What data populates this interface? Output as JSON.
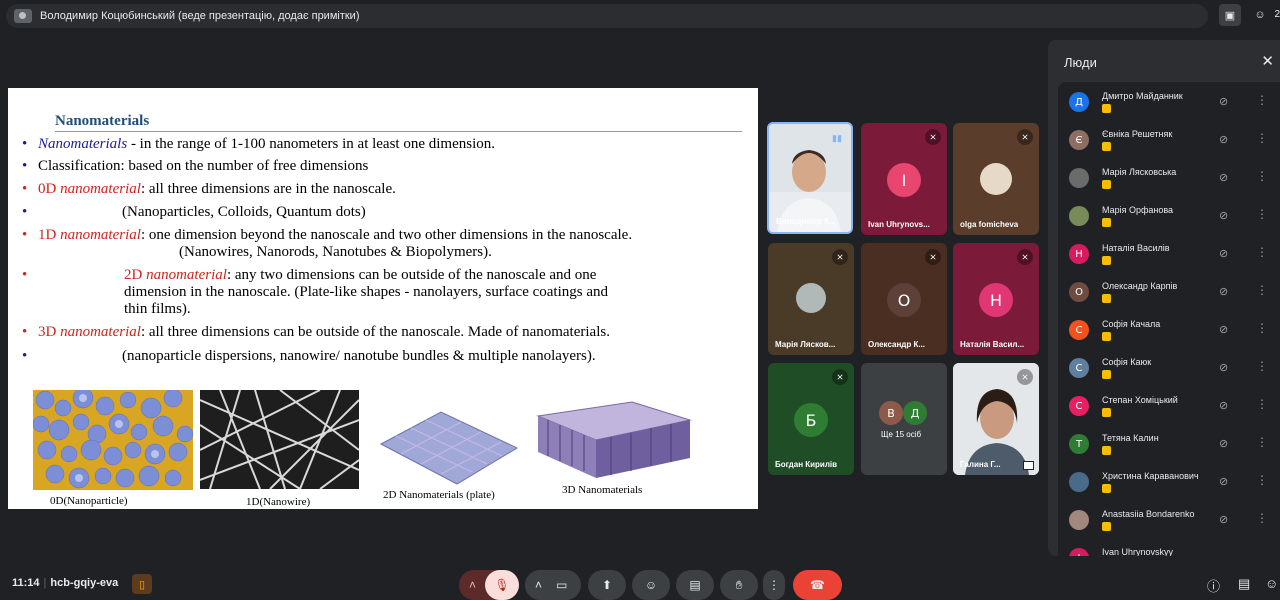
{
  "top": {
    "presenter_text": "Володимир Коцюбинський (веде презентацію, додає примітки)",
    "count": "2"
  },
  "slide": {
    "title": "Nanomaterials",
    "bullets": [
      {
        "lead": "Nanomaterials",
        "rest": " - in the range of 1-100 nanometers in at least one dimension."
      },
      {
        "text": "Classification: based on the number of free dimensions"
      },
      {
        "lead_plain": "0D ",
        "lead": "nanomaterial",
        "rest": ": all three dimensions are in the nanoscale."
      },
      {
        "text": "(Nanoparticles, Colloids, Quantum dots)"
      },
      {
        "lead_plain": "1D ",
        "lead": "nanomaterial",
        "rest": ": one dimension beyond the nanoscale and two other dimensions in the nanoscale.",
        "line2": "(Nanowires, Nanorods, Nanotubes & Biopolymers)."
      },
      {
        "lead_plain": "2D ",
        "lead": "nanomaterial",
        "rest": ": any two dimensions can be outside of the nanoscale and one",
        "line2": "dimension in the nanoscale.       (Plate-like shapes - nanolayers, surface coatings and",
        "line3": "thin films)."
      },
      {
        "lead_plain": "3D ",
        "lead": "nanomaterial",
        "rest": ": all three dimensions can be outside of the nanoscale. Made of nanomaterials."
      },
      {
        "text": "(nanoparticle dispersions, nanowire/ nanotube bundles & multiple nanolayers)."
      }
    ],
    "captions": [
      "0D(Nanoparticle)",
      "1D(Nanowire)",
      "2D Nanomaterials (plate)",
      "3D Nanomaterials"
    ]
  },
  "tiles": [
    {
      "name": "Володимир К...",
      "avatar": ""
    },
    {
      "name": "Ivan Uhrynovs...",
      "avatar": "I"
    },
    {
      "name": "olga fomicheva",
      "avatar": ""
    },
    {
      "name": "Марія Лясков...",
      "avatar": ""
    },
    {
      "name": "Олександр К...",
      "avatar": "О"
    },
    {
      "name": "Наталія Васил...",
      "avatar": "Н"
    },
    {
      "name": "Богдан Кирилів",
      "avatar": "Б"
    },
    {
      "name": "Ще 15 осіб",
      "avatar1": "В",
      "avatar2": "Д"
    },
    {
      "name": "Галина Г...",
      "avatar": ""
    }
  ],
  "panel": {
    "title": "Люди",
    "people": [
      {
        "name": "Дмитро Майданник",
        "initial": "Д",
        "color": "#1a73e8"
      },
      {
        "name": "Євніка Решетняк",
        "initial": "Є",
        "color": "#8d6e63"
      },
      {
        "name": "Марія Лясковська",
        "initial": "",
        "color": "#6b6b6b"
      },
      {
        "name": "Марія Орфанова",
        "initial": "",
        "color": "#7a8b5a"
      },
      {
        "name": "Наталія Василів",
        "initial": "Н",
        "color": "#d81b60"
      },
      {
        "name": "Олександр Карпів",
        "initial": "О",
        "color": "#6d4c41"
      },
      {
        "name": "Софія Качала",
        "initial": "С",
        "color": "#f4511e"
      },
      {
        "name": "Софія Каюк",
        "initial": "С",
        "color": "#5f7f9f"
      },
      {
        "name": "Степан Хоміцький",
        "initial": "С",
        "color": "#e91e63"
      },
      {
        "name": "Тетяна Калин",
        "initial": "Т",
        "color": "#2e7d32"
      },
      {
        "name": "Христина Караванович",
        "initial": "",
        "color": "#4a6a8a"
      },
      {
        "name": "Anastasiia Bondarenko",
        "initial": "",
        "color": "#a1887f"
      },
      {
        "name": "Ivan Uhrynovskyy",
        "initial": "I",
        "color": "#d81b60"
      }
    ]
  },
  "bottom": {
    "time": "11:14",
    "meeting_code": "hcb-gqiy-eva"
  }
}
